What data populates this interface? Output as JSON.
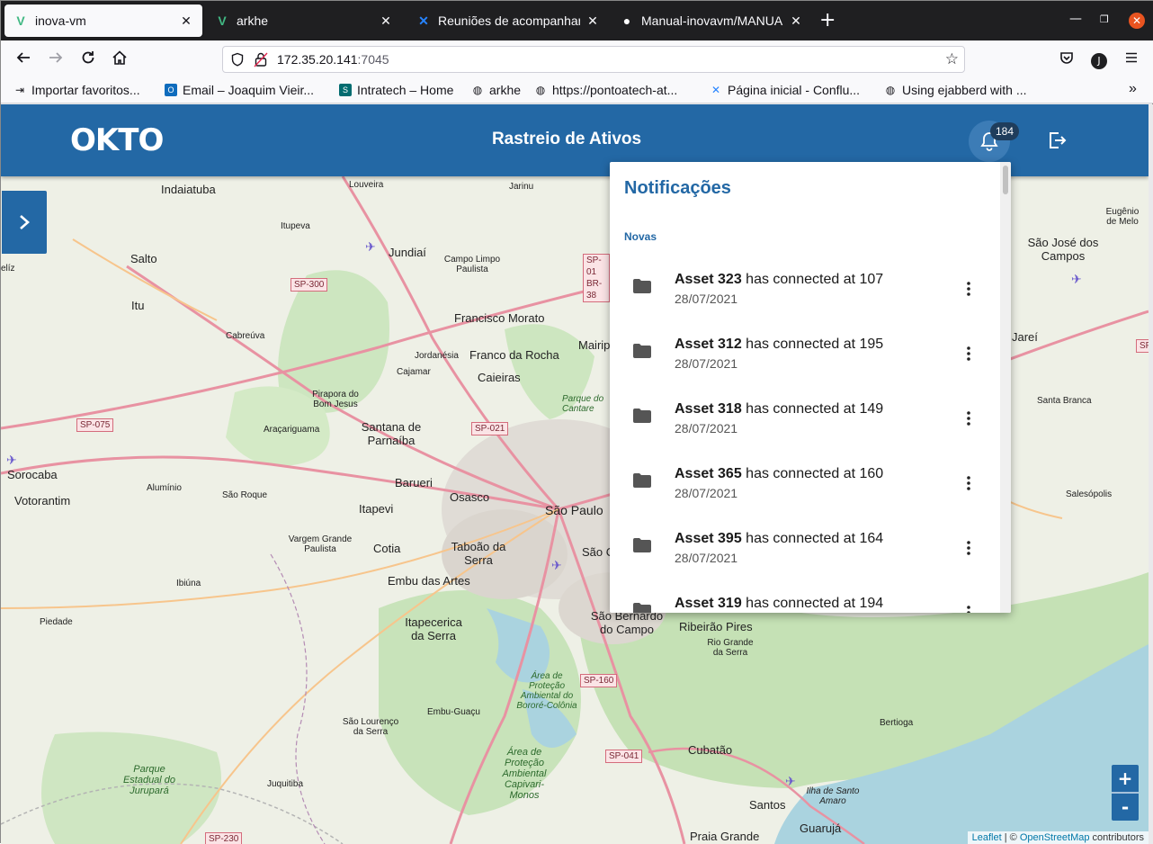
{
  "browser": {
    "tabs": [
      {
        "label": "inova-vm",
        "icon": "vue-icon",
        "active": true
      },
      {
        "label": "arkhe",
        "icon": "vue-icon",
        "active": false
      },
      {
        "label": "Reuniões de acompanhar",
        "icon": "confluence-icon",
        "active": false
      },
      {
        "label": "Manual-inovavm/MANUA",
        "icon": "github-icon",
        "active": false
      }
    ],
    "new_tab": "+",
    "url_host": "172.35.20.141",
    "url_port": ":7045",
    "profile_initial": "J",
    "bookmarks": [
      {
        "label": "Importar favoritos...",
        "icon": "import-icon"
      },
      {
        "label": "Email – Joaquim Vieir...",
        "icon": "outlook-icon"
      },
      {
        "label": "Intratech – Home",
        "icon": "sharepoint-icon"
      },
      {
        "label": "arkhe",
        "icon": "globe-icon"
      },
      {
        "label": "https://pontoatech-at...",
        "icon": "globe-icon"
      },
      {
        "label": "Página inicial - Conflu...",
        "icon": "confluence-icon"
      },
      {
        "label": "Using ejabberd with ...",
        "icon": "globe-icon"
      }
    ],
    "overflow": "»"
  },
  "app": {
    "logo": "OKTO",
    "title": "Rastreio de Ativos",
    "notification_count": "184",
    "accent": "#2368a5"
  },
  "notifications": {
    "title": "Notificações",
    "section": "Novas",
    "items": [
      {
        "asset": "Asset 323",
        "text": " has connected at 107",
        "date": "28/07/2021"
      },
      {
        "asset": "Asset 312",
        "text": " has connected at 195",
        "date": "28/07/2021"
      },
      {
        "asset": "Asset 318",
        "text": " has connected at 149",
        "date": "28/07/2021"
      },
      {
        "asset": "Asset 365",
        "text": " has connected at 160",
        "date": "28/07/2021"
      },
      {
        "asset": "Asset 395",
        "text": " has connected at 164",
        "date": "28/07/2021"
      },
      {
        "asset": "Asset 319",
        "text": " has connected at 194",
        "date": ""
      }
    ]
  },
  "map": {
    "zoom_in": "+",
    "zoom_out": "-",
    "attribution_leaflet": "Leaflet",
    "attribution_sep": " | © ",
    "attribution_osm": "OpenStreetMap",
    "attribution_tail": " contributors",
    "places": [
      {
        "name": "Indaiatuba",
        "size": 13
      },
      {
        "name": "Louveira",
        "size": 10
      },
      {
        "name": "Jarinu",
        "size": 10
      },
      {
        "name": "Itupeva",
        "size": 10
      },
      {
        "name": "Jundiaí",
        "size": 13
      },
      {
        "name": "Salto",
        "size": 13
      },
      {
        "name": "Campo Limpo Paulista",
        "size": 10
      },
      {
        "name": "Itu",
        "size": 13
      },
      {
        "name": "Francisco Morato",
        "size": 13
      },
      {
        "name": "Cabreúva",
        "size": 10
      },
      {
        "name": "Franco da Rocha",
        "size": 13
      },
      {
        "name": "Mairip",
        "size": 13
      },
      {
        "name": "Jordanésia",
        "size": 10
      },
      {
        "name": "Caieiras",
        "size": 13
      },
      {
        "name": "Cajamar",
        "size": 10
      },
      {
        "name": "Pirapora do Bom Jesus",
        "size": 10
      },
      {
        "name": "Santana de Parnaíba",
        "size": 13
      },
      {
        "name": "Araçariguama",
        "size": 10
      },
      {
        "name": "Sorocaba",
        "size": 13
      },
      {
        "name": "Votorantim",
        "size": 13
      },
      {
        "name": "Alumínio",
        "size": 10
      },
      {
        "name": "São Roque",
        "size": 10
      },
      {
        "name": "Barueri",
        "size": 13
      },
      {
        "name": "Osasco",
        "size": 13
      },
      {
        "name": "Itapevi",
        "size": 13
      },
      {
        "name": "São Paulo",
        "size": 14
      },
      {
        "name": "Vargem Grande Paulista",
        "size": 10
      },
      {
        "name": "Cotia",
        "size": 13
      },
      {
        "name": "Taboão da Serra",
        "size": 13
      },
      {
        "name": "Embu das Artes",
        "size": 13
      },
      {
        "name": "Ibiúna",
        "size": 10
      },
      {
        "name": "Piedade",
        "size": 10
      },
      {
        "name": "Itapecerica da Serra",
        "size": 13
      },
      {
        "name": "São Bernardo do Campo",
        "size": 13
      },
      {
        "name": "Ribeirão Pires",
        "size": 13
      },
      {
        "name": "Rio Grande da Serra",
        "size": 10
      },
      {
        "name": "Embu-Guaçu",
        "size": 10
      },
      {
        "name": "São Lourenço da Serra",
        "size": 10
      },
      {
        "name": "Parque Estadual do Jurupará",
        "size": 11
      },
      {
        "name": "Juquitiba",
        "size": 10
      },
      {
        "name": "Cubatão",
        "size": 13
      },
      {
        "name": "Santos",
        "size": 13
      },
      {
        "name": "Guarujá",
        "size": 13
      },
      {
        "name": "Praia Grande",
        "size": 13
      },
      {
        "name": "Bertioga",
        "size": 10
      },
      {
        "name": "Ilha de Santo Amaro",
        "size": 10
      },
      {
        "name": "São José dos Campos",
        "size": 13
      },
      {
        "name": "Eugênio de Melo",
        "size": 10
      },
      {
        "name": "Santa Branca",
        "size": 10
      },
      {
        "name": "Salesópolis",
        "size": 10
      },
      {
        "name": "Área de Proteção Ambiental do Bororé-Colônia",
        "size": 10
      },
      {
        "name": "Área de Proteção Ambiental Capivari-Monos",
        "size": 11
      },
      {
        "name": "Parque do Cantare",
        "size": 10
      },
      {
        "name": "elíz",
        "size": 10
      },
      {
        "name": "Jareí",
        "size": 13
      },
      {
        "name": "São C",
        "size": 13
      }
    ],
    "roads": [
      "SP-300",
      "SP-01 BR-38",
      "SP-075",
      "SP-021",
      "SP-160",
      "SP-041",
      "SP-230",
      "SP"
    ]
  }
}
